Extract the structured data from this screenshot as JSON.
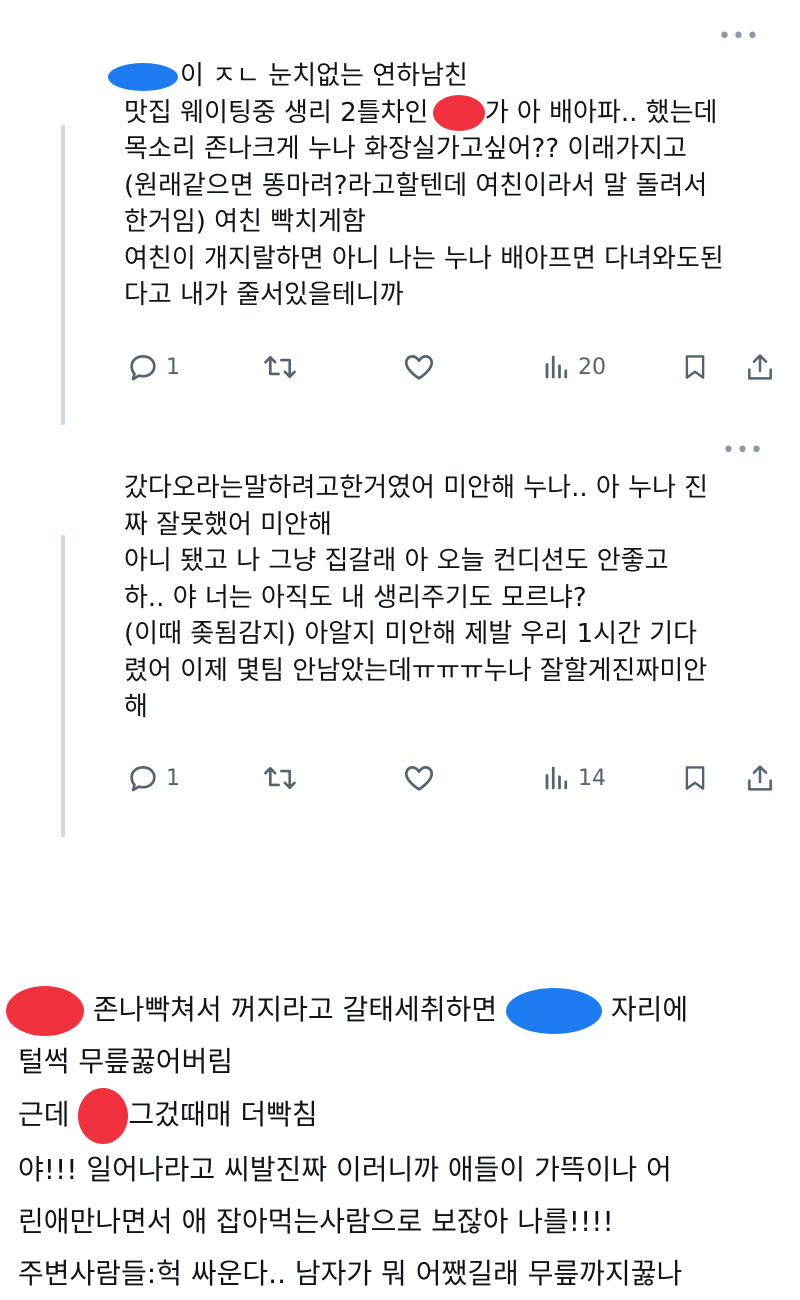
{
  "tweet1": {
    "more_label": "•••",
    "lines": [
      "이 ㅈㄴ 눈치없는 연하남친",
      "맛집 웨이팅중 생리 2틀차인 ",
      "가 아 배아파.. 했는데",
      "목소리 존나크게 누나 화장실가고싶어?? 이래가지고",
      "(원래같으면 똥마려?라고할텐데 여친이라서 말 돌려서",
      "한거임) 여친 빡치게함",
      "여친이 개지랄하면 아니 나는 누나 배아프면 다녀와도된",
      "다고 내가 줄서있을테니까"
    ],
    "replies": "1",
    "views": "20"
  },
  "tweet2": {
    "more_label": "•••",
    "lines": [
      "갔다오라는말하려고한거였어 미안해 누나.. 아 누나 진",
      "짜 잘못했어 미안해",
      "아니 됐고 나 그냥 집갈래 아 오늘 컨디션도 안좋고",
      "하.. 야 너는 아직도 내 생리주기도 모르냐?",
      "(이때 좆됨감지)  아알지 미안해 제발 우리 1시간 기다",
      "렸어 이제 몇팀 안남았는데ㅠㅠㅠ누나 잘할게진짜미안",
      "해"
    ],
    "replies": "1",
    "views": "14"
  },
  "footer": {
    "lines": [
      " 존나빡쳐서 꺼지라고 갈태세취하면 ",
      " 자리에",
      "털썩 무릎꿇어버림",
      "근데 ",
      "그겄때매 더빡침",
      "야!!! 일어나라고 씨발진짜 이러니까 애들이 가뜩이나 어",
      "린애만나면서 애 잡아먹는사람으로 보잖아 나를!!!!",
      "주변사람들:헉 싸운다.. 남자가 뭐 어쨌길래 무릎까지꿇나"
    ]
  },
  "colors": {
    "redact_blue": "#1d7cf2",
    "redact_red": "#f2313f",
    "icon_gray": "#536471"
  }
}
